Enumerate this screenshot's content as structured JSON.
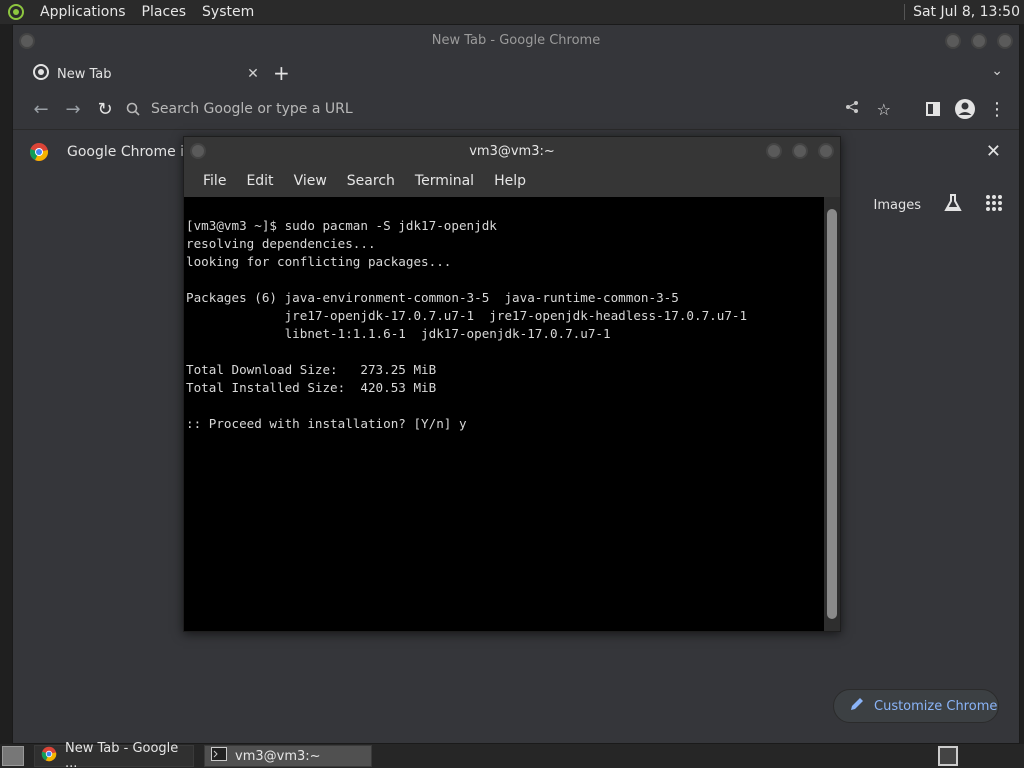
{
  "top_panel": {
    "menus": [
      "Applications",
      "Places",
      "System"
    ],
    "clock": "Sat Jul  8, 13:50"
  },
  "chrome": {
    "window_title": "New Tab - Google Chrome",
    "tab_title": "New Tab",
    "omnibox_placeholder": "Search Google or type a URL",
    "infobar_text": "Google Chrome isn",
    "images_link": "Images",
    "customize_label": "Customize Chrome"
  },
  "terminal": {
    "title": "vm3@vm3:~",
    "menus": [
      "File",
      "Edit",
      "View",
      "Search",
      "Terminal",
      "Help"
    ],
    "lines": [
      "[vm3@vm3 ~]$ sudo pacman -S jdk17-openjdk",
      "resolving dependencies...",
      "looking for conflicting packages...",
      "",
      "Packages (6) java-environment-common-3-5  java-runtime-common-3-5",
      "             jre17-openjdk-17.0.7.u7-1  jre17-openjdk-headless-17.0.7.u7-1",
      "             libnet-1:1.1.6-1  jdk17-openjdk-17.0.7.u7-1",
      "",
      "Total Download Size:   273.25 MiB",
      "Total Installed Size:  420.53 MiB",
      "",
      ":: Proceed with installation? [Y/n] y"
    ]
  },
  "taskbar": {
    "tasks": [
      "New Tab - Google ...",
      "vm3@vm3:~"
    ]
  },
  "colors": {
    "accent": "#8ab4f8",
    "chrome_bg": "#35363a",
    "terminal_bg": "#000000"
  }
}
